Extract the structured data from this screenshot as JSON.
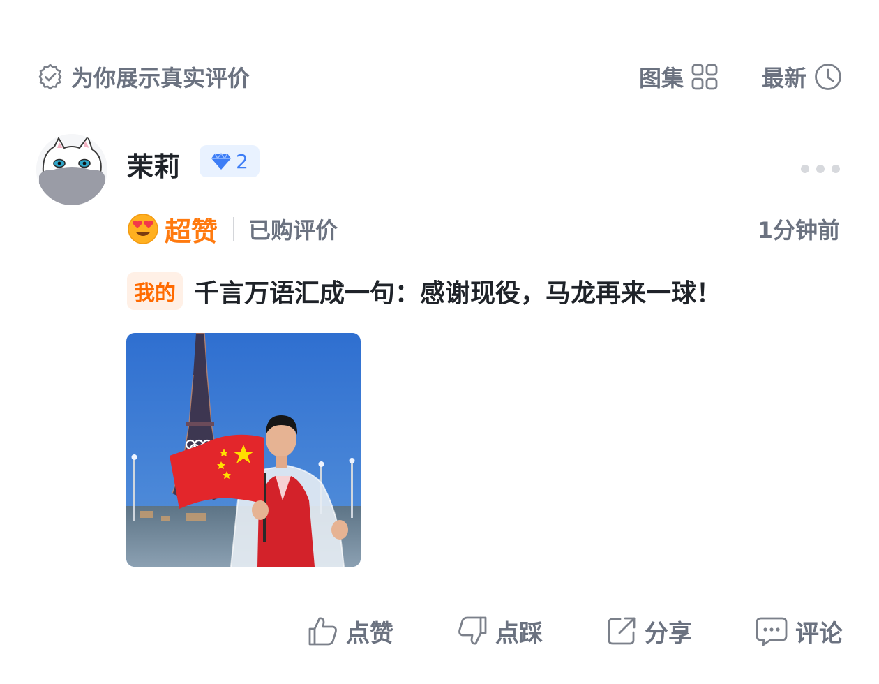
{
  "top_bar": {
    "genuine_label": "为你展示真实评价",
    "gallery_label": "图集",
    "latest_label": "最新"
  },
  "review": {
    "username": "茉莉",
    "level": "2",
    "rating_label": "超赞",
    "purchased_label": "已购评价",
    "time": "1分钟前",
    "mine_tag": "我的",
    "content": "千言万语汇成一句：感谢现役，马龙再来一球！"
  },
  "actions": {
    "like": "点赞",
    "dislike": "点踩",
    "share": "分享",
    "comment": "评论"
  },
  "colors": {
    "accent_orange": "#ff7a0f",
    "level_blue": "#3d7df6",
    "muted_text": "#6b7280"
  },
  "icons": {
    "verified": "shield-check-icon",
    "gallery": "grid-icon",
    "latest": "clock-icon",
    "level": "diamond-icon",
    "like": "thumbs-up-icon",
    "dislike": "thumbs-down-icon",
    "share": "share-icon",
    "comment": "comment-icon"
  }
}
